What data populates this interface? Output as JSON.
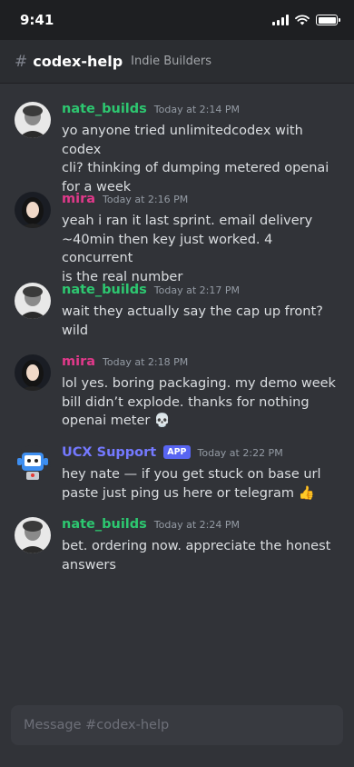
{
  "status_bar": {
    "time": "9:41"
  },
  "header": {
    "hash": "#",
    "channel": "codex-help",
    "server": "Indie Builders"
  },
  "messages": [
    {
      "author": "nate_builds",
      "time": "Today at 2:14 PM",
      "text": "yo anyone tried unlimitedcodex with codex\ncli? thinking of dumping metered openai\nfor a week"
    },
    {
      "author": "mira",
      "time": "Today at 2:16 PM",
      "text": "yeah i ran it last sprint. email delivery\n~40min then key just worked. 4 concurrent\nis the real number"
    },
    {
      "author": "nate_builds",
      "time": "Today at 2:17 PM",
      "text": "wait they actually say the cap up front?\nwild"
    },
    {
      "author": "mira",
      "time": "Today at 2:18 PM",
      "text": "lol yes. boring packaging. my demo week\nbill didn’t explode. thanks for nothing\nopenai meter 💀"
    },
    {
      "author": "UCX Support",
      "badge": "APP",
      "time": "Today at 2:22 PM",
      "text": "hey nate — if you get stuck on base url\npaste just ping us here or telegram 👍"
    },
    {
      "author": "nate_builds",
      "time": "Today at 2:24 PM",
      "text": "bet. ordering now. appreciate the honest\nanswers"
    }
  ],
  "composer": {
    "placeholder": "Message #codex-help"
  },
  "colors": {
    "nate": "#2dc770",
    "mira": "#e0398a",
    "ucx": "#7479ff",
    "badge": "#5865f2"
  }
}
